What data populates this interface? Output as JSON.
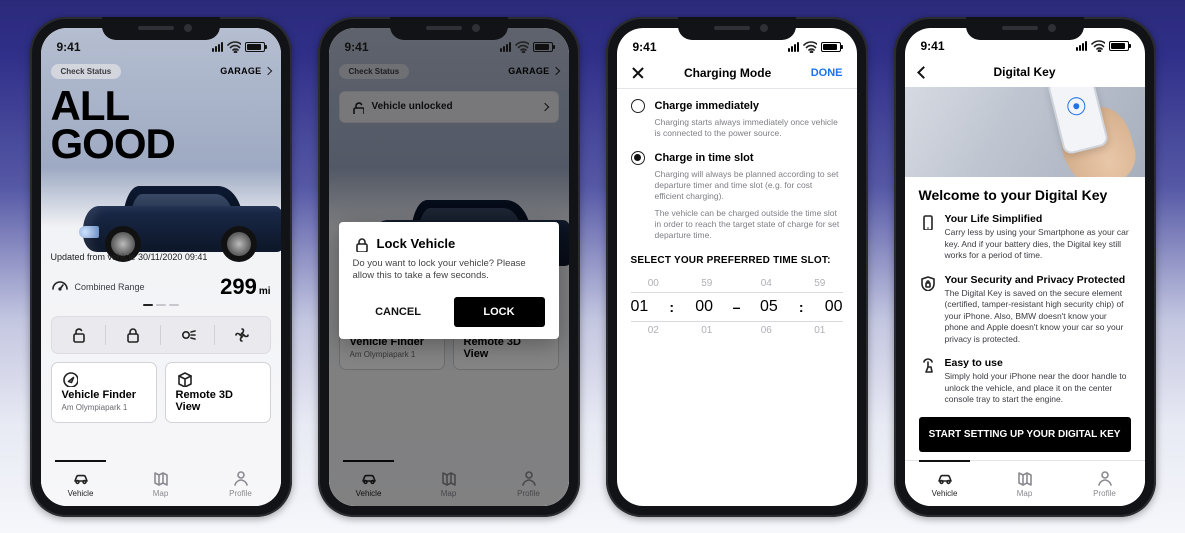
{
  "status": {
    "time": "9:41"
  },
  "home": {
    "check_status": "Check Status",
    "garage": "GARAGE",
    "hero": "ALL\nGOOD",
    "updated": "Updated from vehicle 30/11/2020 09:41",
    "range_label": "Combined Range",
    "range_value": "299",
    "range_unit": "mi",
    "actions": [
      "unlock",
      "lock",
      "lights",
      "climate"
    ],
    "vehicle_unlocked": "Vehicle unlocked",
    "cards": {
      "finder_title": "Vehicle Finder",
      "finder_sub": "Am Olympiapark 1",
      "view3d_title": "Remote 3D View"
    }
  },
  "modal": {
    "title": "Lock Vehicle",
    "body": "Do you want to lock your vehicle? Please allow this to take a few seconds.",
    "cancel": "CANCEL",
    "confirm": "LOCK"
  },
  "tabs": {
    "vehicle": "Vehicle",
    "map": "Map",
    "profile": "Profile"
  },
  "charging": {
    "title": "Charging Mode",
    "done": "DONE",
    "opt1_title": "Charge immediately",
    "opt1_desc": "Charging starts always immediately once vehicle is connected to the power source.",
    "opt2_title": "Charge in time slot",
    "opt2_desc1": "Charging will always be planned according to set departure timer and time slot (e.g. for cost efficient charging).",
    "opt2_desc2": "The vehicle can be charged outside the time slot in order to reach the target state of charge for set departure time.",
    "section": "SELECT YOUR PREFERRED TIME SLOT:",
    "picker": {
      "row_above": [
        "00",
        "59",
        "04",
        "59"
      ],
      "row_faint_above": [
        "",
        "",
        "",
        ""
      ],
      "dash": "–",
      "colon": ":",
      "current": [
        "01",
        "00",
        "05",
        "00"
      ],
      "row_below": [
        "02",
        "01",
        "06",
        "01"
      ],
      "row_faint_below": [
        "",
        "",
        "",
        ""
      ]
    }
  },
  "digitalkey": {
    "title": "Digital Key",
    "welcome": "Welcome to your Digital Key",
    "feat1_title": "Your Life Simplified",
    "feat1_desc": "Carry less by using your Smartphone as your car key.  And if your battery dies, the Digital key still works for a period of time.",
    "feat2_title": "Your Security and Privacy Protected",
    "feat2_desc": "The Digital Key is saved on the secure element (certified, tamper-resistant high security chip) of your iPhone. Also, BMW doesn't know your phone and Apple doesn't know your car so your privacy is protected.",
    "feat3_title": "Easy to use",
    "feat3_desc": "Simply hold your iPhone near the door handle to unlock the vehicle, and place it on the center console tray to start the engine.",
    "cta": "START SETTING UP YOUR DIGITAL KEY"
  }
}
